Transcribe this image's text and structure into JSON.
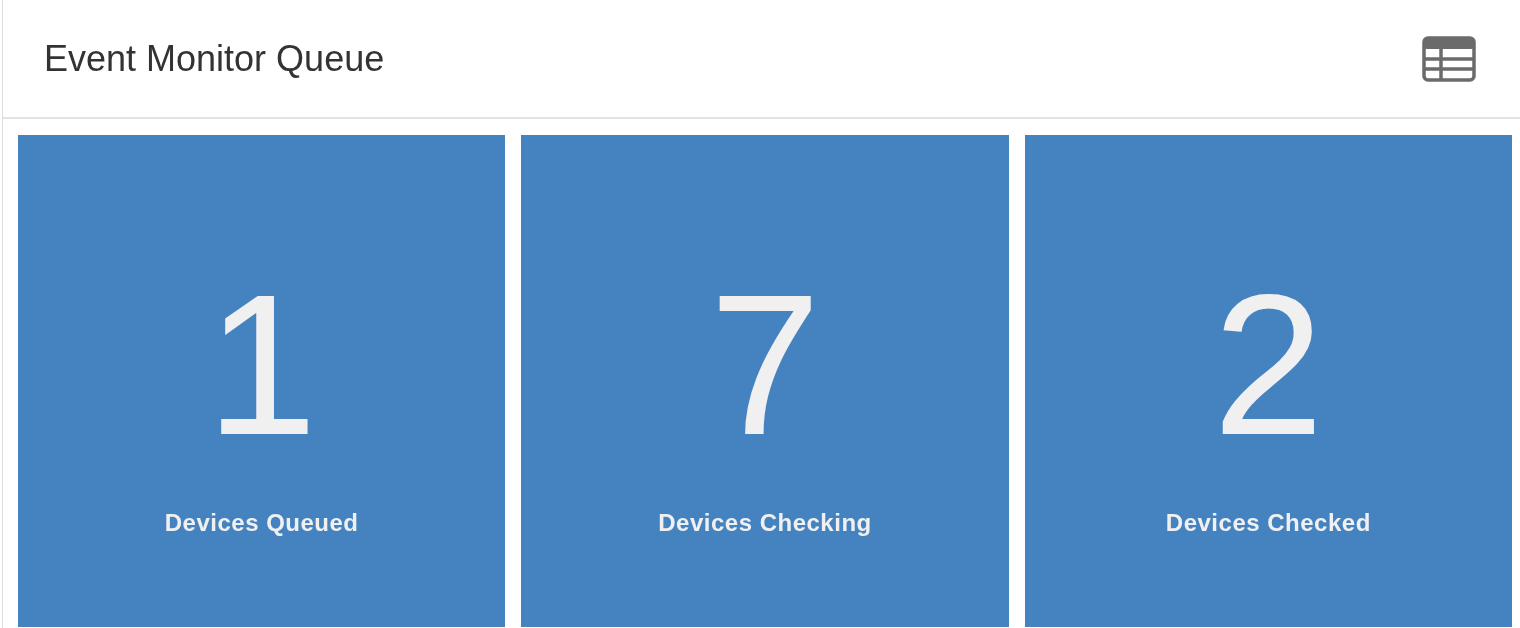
{
  "panel": {
    "title": "Event Monitor Queue"
  },
  "tiles": [
    {
      "value": "1",
      "label": "Devices Queued"
    },
    {
      "value": "7",
      "label": "Devices Checking"
    },
    {
      "value": "2",
      "label": "Devices Checked"
    }
  ]
}
